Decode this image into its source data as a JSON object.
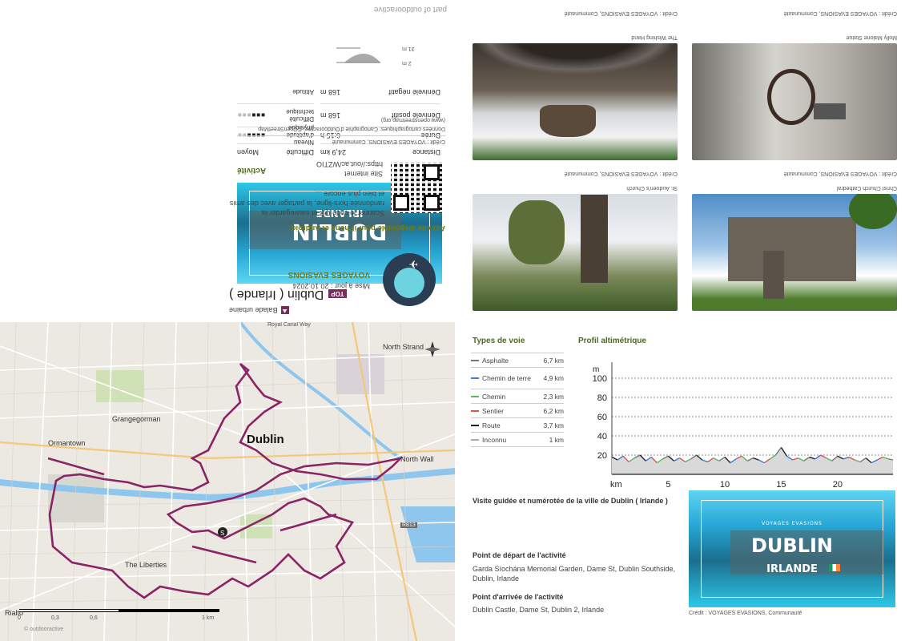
{
  "header": {
    "watermark": "part of outdooractive",
    "category": "Balade urbaine",
    "top_badge": "TOP",
    "title": "Dublin ( Irlande )"
  },
  "activity": {
    "heading": "Activité",
    "stats": [
      {
        "label": "Distance",
        "value": "24,9 km"
      },
      {
        "label": "Durée",
        "value": "6:15 h"
      },
      {
        "label": "Dénivelé positif",
        "value": "168 m"
      },
      {
        "label": "Dénivelé négatif",
        "value": "168 m"
      }
    ],
    "ratings": [
      {
        "label": "Difficulté",
        "value": "Moyen"
      },
      {
        "label": "Niveau d'aptitude physique",
        "filled": 4,
        "total": 6
      },
      {
        "label": "Difficulté technique",
        "filled": 3,
        "total": 6
      },
      {
        "label": "Altitude",
        "max": "31 m",
        "min": "2 m"
      }
    ]
  },
  "promo": {
    "app_title": "Activité disponible pour iPhone et Android.",
    "app_text": "Scanner le code QR et sauvegarder la randonnée hors-ligne, la partager avec des amis et bien plus encore ...",
    "site_label": "Site internet",
    "site_url": "https://out.ac/WZTIO",
    "author": "VOYAGES EVASIONS",
    "updated": "Mise à jour : 20.10.2024",
    "credit": "Crédit : VOYAGES EVASIONS, Communauté",
    "map_source": "Données cartographiques: Cartographie d'Outdooractive; ©OpenStreetMap (www.openstreetmap.org)"
  },
  "photos": [
    {
      "caption": "The Wishing Hand",
      "credit": "Crédit : VOYAGES EVASIONS, Communauté"
    },
    {
      "caption": "Molly Malone Statue",
      "credit": "Crédit : VOYAGES EVASIONS, Communauté"
    },
    {
      "caption": "St. Audoen's Church",
      "credit": "Crédit : VOYAGES EVASIONS, Communauté"
    },
    {
      "caption": "Christ Church Cathedral",
      "credit": "Crédit : VOYAGES EVASIONS, Communauté"
    }
  ],
  "map": {
    "labels": {
      "dublin": "Dublin",
      "north_strand": "North Strand",
      "grangegorman": "Grangegorman",
      "ormantown": "Ormantown",
      "north_wall": "North Wall",
      "liberties": "The Liberties",
      "rialto": "Rialto",
      "canal": "Royal Canal Way",
      "road": "R813"
    },
    "scale": [
      "0",
      "0,3",
      "0,6",
      "1 km"
    ],
    "logo": "© outdooractive"
  },
  "surface_types": {
    "title": "Types de voie",
    "rows": [
      {
        "name": "Asphalte",
        "value": "6,7 km",
        "color": "#777777"
      },
      {
        "name": "Chemin de terre",
        "value": "4,9 km",
        "color": "#3a7bd5"
      },
      {
        "name": "Chemin",
        "value": "2,3 km",
        "color": "#5cb85c"
      },
      {
        "name": "Sentier",
        "value": "6,2 km",
        "color": "#e05050"
      },
      {
        "name": "Route",
        "value": "3,7 km",
        "color": "#222222"
      },
      {
        "name": "Inconnu",
        "value": "1 km",
        "color": "#aaaaaa"
      }
    ]
  },
  "chart_data": {
    "type": "line",
    "title": "Profil altimétrique",
    "ylabel": "m",
    "xlabel": "km",
    "ylim": [
      0,
      100
    ],
    "yticks": [
      20,
      40,
      60,
      80,
      100
    ],
    "xlim": [
      0,
      24.9
    ],
    "xticks": [
      5,
      10,
      15,
      20
    ],
    "x": [
      0,
      0.5,
      1,
      1.5,
      2,
      2.5,
      3,
      3.5,
      4,
      4.5,
      5,
      5.5,
      6,
      6.5,
      7,
      7.5,
      8,
      8.5,
      9,
      9.5,
      10,
      10.5,
      11,
      11.5,
      12,
      12.5,
      13,
      13.5,
      14,
      14.5,
      15,
      15.5,
      16,
      16.5,
      17,
      17.5,
      18,
      18.5,
      19,
      19.5,
      20,
      20.5,
      21,
      21.5,
      22,
      22.5,
      23,
      23.5,
      24,
      24.5,
      24.9
    ],
    "y": [
      18,
      15,
      19,
      13,
      17,
      20,
      14,
      18,
      12,
      16,
      19,
      14,
      17,
      13,
      16,
      20,
      15,
      13,
      17,
      14,
      18,
      12,
      16,
      19,
      14,
      17,
      15,
      12,
      16,
      20,
      28,
      19,
      15,
      17,
      14,
      18,
      16,
      20,
      17,
      14,
      19,
      16,
      18,
      15,
      13,
      17,
      12,
      15,
      18,
      16,
      15
    ]
  },
  "description": {
    "heading": "Visite guidée et numérotée de la ville de Dublin ( Irlande )",
    "start_title": "Point de départ de l'activité",
    "start_text": "Garda Síochána Memorial Garden, Dame St, Dublin Southside, Dublin, Irlande",
    "end_title": "Point d'arrivée de l'activité",
    "end_text": "Dublin Castle, Dame St, Dublin 2, Irlande"
  },
  "cover": {
    "subtitle": "VOYAGES EVASIONS",
    "title": "DUBLIN",
    "country": "IRLANDE",
    "credit": "Crédit : VOYAGES EVASIONS, Communauté"
  }
}
